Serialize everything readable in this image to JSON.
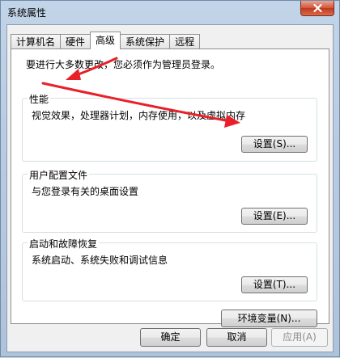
{
  "window": {
    "title": "系统属性"
  },
  "tabs": [
    {
      "label": "计算机名"
    },
    {
      "label": "硬件"
    },
    {
      "label": "高级",
      "active": true
    },
    {
      "label": "系统保护"
    },
    {
      "label": "远程"
    }
  ],
  "notice": "要进行大多数更改，您必须作为管理员登录。",
  "groups": {
    "performance": {
      "title": "性能",
      "desc": "视觉效果，处理器计划，内存使用，以及虚拟内存",
      "button": "设置(S)..."
    },
    "user_profiles": {
      "title": "用户配置文件",
      "desc": "与您登录有关的桌面设置",
      "button": "设置(E)..."
    },
    "startup_recovery": {
      "title": "启动和故障恢复",
      "desc": "系统启动、系统失败和调试信息",
      "button": "设置(T)..."
    }
  },
  "env_button": "环境变量(N)...",
  "footer": {
    "ok": "确定",
    "cancel": "取消",
    "apply": "应用(A)"
  },
  "colors": {
    "annotation_arrow": "#e8202a"
  },
  "icons": {
    "close": "close-icon"
  }
}
